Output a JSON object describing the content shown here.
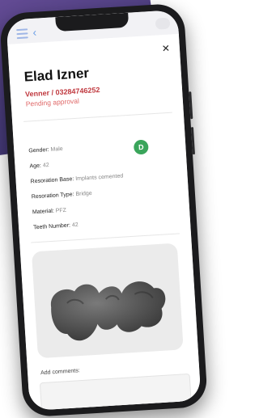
{
  "patient": {
    "name": "Elad Izner",
    "subtitle": "Venner / 03284746252",
    "status": "Pending approval"
  },
  "details": [
    {
      "label": "Gender:",
      "value": "Male"
    },
    {
      "label": "Age:",
      "value": "42"
    },
    {
      "label": "Resoration Base:",
      "value": "Implants cemented"
    },
    {
      "label": "Resoration Type:",
      "value": "Bridge"
    },
    {
      "label": "Material:",
      "value": "PFZ"
    },
    {
      "label": "Teeth Number:",
      "value": "42"
    }
  ],
  "avatar": {
    "initial": "D",
    "color": "#3aa55b"
  },
  "comments": {
    "label": "Add comments:",
    "placeholder": ""
  },
  "icons": {
    "close": "close-icon",
    "menu": "menu-icon",
    "back": "back-icon",
    "search": "search-icon"
  }
}
